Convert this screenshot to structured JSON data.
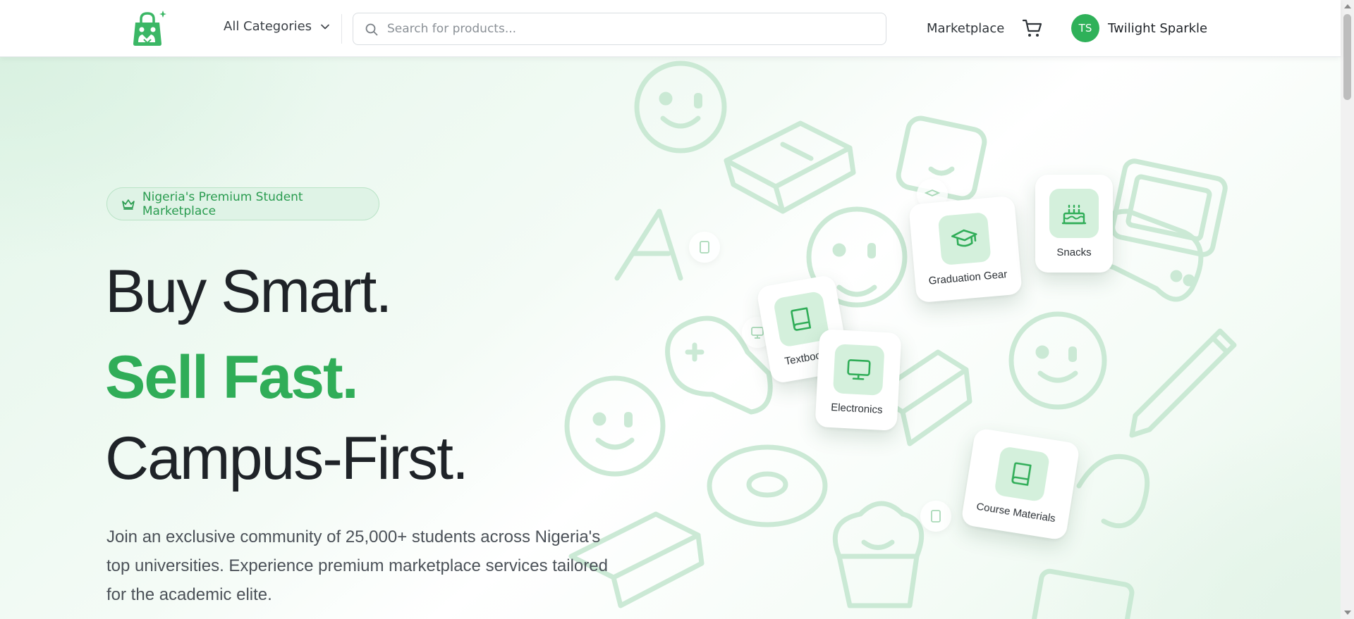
{
  "header": {
    "categories_label": "All Categories",
    "search_placeholder": "Search for products...",
    "marketplace_link": "Marketplace",
    "user": {
      "initials": "TS",
      "name": "Twilight Sparkle"
    }
  },
  "hero": {
    "badge": "Nigeria's Premium Student Marketplace",
    "headline": [
      "Buy Smart.",
      "Sell Fast.",
      "Campus-First."
    ],
    "description": "Join an exclusive community of 25,000+ students across Nigeria's top universities. Experience premium marketplace services tailored for the academic elite."
  },
  "category_cards": [
    {
      "label": "Graduation Gear",
      "icon": "graduation-cap-icon"
    },
    {
      "label": "Snacks",
      "icon": "cake-icon"
    },
    {
      "label": "Textbooks",
      "icon": "book-icon"
    },
    {
      "label": "Electronics",
      "icon": "monitor-icon"
    },
    {
      "label": "Course Materials",
      "icon": "book-icon"
    }
  ],
  "colors": {
    "accent": "#30ad58",
    "accent_light": "#d4f0dc",
    "text": "#1f2328"
  }
}
